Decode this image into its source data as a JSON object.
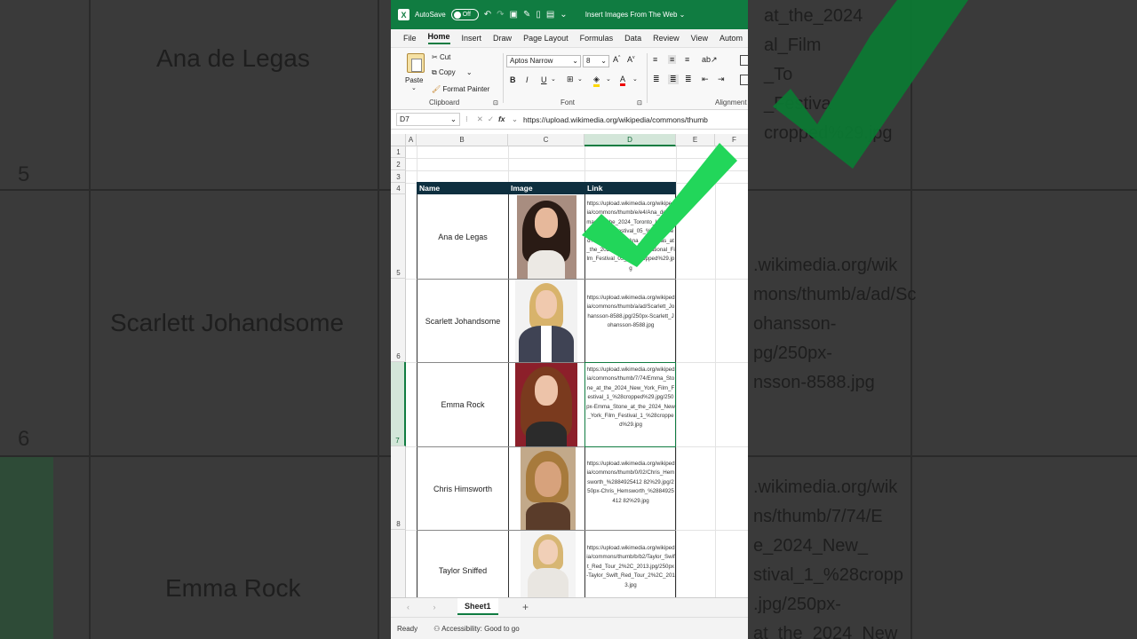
{
  "titlebar": {
    "autosave_label": "AutoSave",
    "toggle_state": "Off",
    "document_title": "Insert Images From The Web"
  },
  "menu": [
    "File",
    "Home",
    "Insert",
    "Draw",
    "Page Layout",
    "Formulas",
    "Data",
    "Review",
    "View",
    "Autom"
  ],
  "ribbon": {
    "paste": "Paste",
    "cut": "Cut",
    "copy": "Copy",
    "format_painter": "Format Painter",
    "clipboard_label": "Clipboard",
    "font_name": "Aptos Narrow",
    "font_size": "8",
    "font_label": "Font",
    "alignment_label": "Alignment"
  },
  "formula_bar": {
    "cell_ref": "D7",
    "formula": "https://upload.wikimedia.org/wikipedia/commons/thumb"
  },
  "columns": [
    "A",
    "B",
    "C",
    "D",
    "E",
    "F"
  ],
  "rows": [
    "1",
    "2",
    "3",
    "4",
    "5",
    "6",
    "7",
    "8"
  ],
  "table": {
    "headers": [
      "Name",
      "Image",
      "Link"
    ],
    "rows": [
      {
        "name": "Ana de Legas",
        "link": "https://upload.wikimedia.org/wikipedia/commons/thumb/e/e4/Ana_de_Armas_at_the_2024_Toronto_International_Film_Festival_05_%28cropped%29.jpg/250px-Ana_de_Armas_at_the_2024_Toronto_International_Film_Festival_05_%28cropped%29.jpg"
      },
      {
        "name": "Scarlett Johandsome",
        "link": "https://upload.wikimedia.org/wikipedia/commons/thumb/a/ad/Scarlett_Johansson-8588.jpg/250px-Scarlett_Johansson-8588.jpg"
      },
      {
        "name": "Emma Rock",
        "link": "https://upload.wikimedia.org/wikipedia/commons/thumb/7/74/Emma_Stone_at_the_2024_New_York_Film_Festival_1_%28cropped%29.jpg/250px-Emma_Stone_at_the_2024_New_York_Film_Festival_1_%28cropped%29.jpg"
      },
      {
        "name": "Chris Himsworth",
        "link": "https://upload.wikimedia.org/wikipedia/commons/thumb/0/02/Chris_Hemsworth_%2884925412 82%29.jpg/250px-Chris_Hemsworth_%2884925412 82%29.jpg"
      },
      {
        "name": "Taylor Sniffed",
        "link": "https://upload.wikimedia.org/wikipedia/commons/thumb/b/b2/Taylor_Swift_Red_Tour_2%2C_2013.jpg/250px-Taylor_Swift_Red_Tour_2%2C_2013.jpg"
      }
    ]
  },
  "sheet_tab": "Sheet1",
  "status": {
    "ready": "Ready",
    "accessibility": "Accessibility: Good to go"
  },
  "background": {
    "left_names": [
      "Ana de Legas",
      "Scarlett Johandsome",
      "Emma Rock"
    ],
    "left_rownums": [
      "5",
      "6"
    ],
    "right_text_1": "at_the_2024\nal_Film\n_To\n_Festiva\ncropped%29.jpg",
    "right_text_2": ".wikimedia.org/wik\nmons/thumb/a/ad/Sc\nohansson-\npg/250px-\nnsson-8588.jpg",
    "right_text_3": ".wikimedia.org/wik\nns/thumb/7/74/E\ne_2024_New_\nstival_1_%28cropp\n.jpg/250px-\nat_the_2024_New"
  },
  "colors": {
    "excel_green": "#107c41",
    "header_dark": "#0e2f3f",
    "check_green": "#22d65a"
  }
}
